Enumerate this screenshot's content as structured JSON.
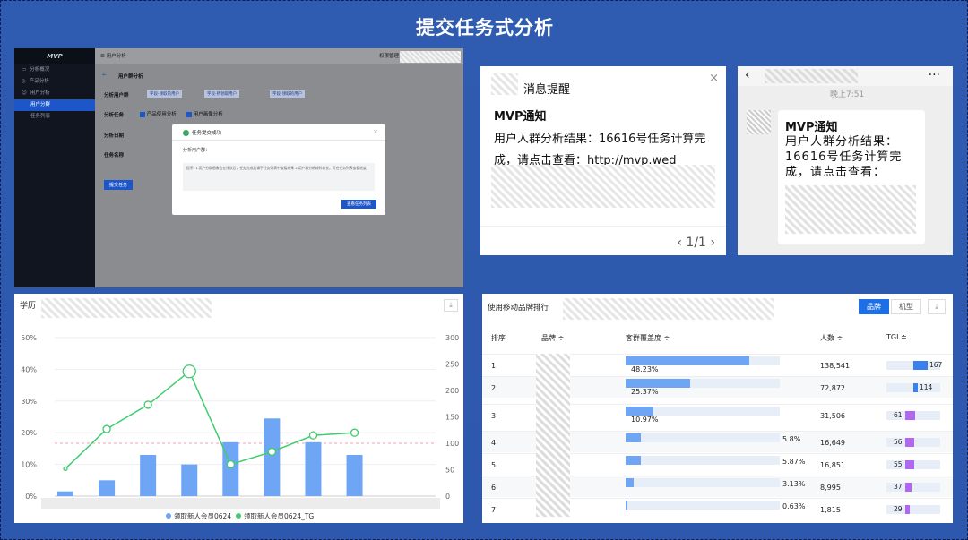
{
  "title": "提交任务式分析",
  "app": {
    "logo": "MVP",
    "topbar_left": "用户分析",
    "topbar_right": "权限管理",
    "nav": [
      {
        "label": "分析概况",
        "active": false,
        "sub": false
      },
      {
        "label": "产品分析",
        "active": false,
        "sub": false
      },
      {
        "label": "用户分析",
        "active": false,
        "sub": false
      },
      {
        "label": "用户分群",
        "active": true,
        "sub": true
      },
      {
        "label": "任务列表",
        "active": false,
        "sub": true
      }
    ],
    "page_title": "用户群分析",
    "form_labels": {
      "users": "分析用户群",
      "task": "分析任务",
      "date": "分析日期",
      "name": "任务名称"
    },
    "tags": [
      "字段-领取的用户",
      "字段-所领取用户",
      "字段-领取的用户"
    ],
    "task_options": [
      "产品使用分析",
      "用户画像分析"
    ],
    "submit": "提交任务",
    "modal": {
      "title": "任务提交成功",
      "field": "分析用户群：",
      "tips": "提示:\n1.用户分群画像会在排队后，任务完成后请于任务列表中查看结果\n2.用户群分析耗时较长，可在任务列表查看进度",
      "button": "查看任务列表"
    }
  },
  "notice": {
    "header": "消息提醒",
    "title": "MVP通知",
    "body": "用户人群分析结果：16616号任务计算完成，请点击查看：http://mvp.wed",
    "pager": "‹ 1/1 ›"
  },
  "chat": {
    "time": "晚上7:51",
    "title": "MVP通知",
    "body": "用户人群分析结果：16616号任务计算完成，请点击查看："
  },
  "education_chart": {
    "title": "学历",
    "legend": [
      "领取新人会员0624",
      "领取新人会员0624_TGI"
    ],
    "colors": {
      "bar": "#6ea6f5",
      "line": "#3fcc6e",
      "ref": "#f0a0b0"
    }
  },
  "chart_data": {
    "type": "bar",
    "title": "学历",
    "categories": [
      "",
      "",
      "",
      "",
      "",
      "",
      "",
      "",
      ""
    ],
    "series": [
      {
        "name": "领取新人会员0624",
        "values": [
          1.5,
          5,
          13,
          10,
          17,
          24.5,
          17,
          13,
          0
        ]
      },
      {
        "name": "领取新人会员0624_TGI",
        "values": [
          52,
          127,
          173,
          236,
          60,
          84,
          115,
          120,
          null
        ]
      }
    ],
    "y_left_ticks": [
      "0%",
      "10%",
      "20%",
      "30%",
      "40%",
      "50%"
    ],
    "y_right_ticks": [
      "0",
      "50",
      "100",
      "150",
      "200",
      "250",
      "300"
    ],
    "ylim": [
      0,
      50
    ],
    "y2lim": [
      0,
      300
    ],
    "reference_y2": 100
  },
  "brand_table": {
    "title": "使用移动品牌排行",
    "toggle": [
      "品牌",
      "机型"
    ],
    "headers": [
      "排序",
      "品牌 ≑",
      "客群覆盖度 ≑",
      "人数 ≑",
      "TGI ≑"
    ],
    "rows": [
      {
        "rank": "1",
        "coverage": "48.23%",
        "coverage_value": 48.23,
        "count": "138,541",
        "tgi": "167",
        "tgi_value": 167
      },
      {
        "rank": "2",
        "coverage": "25.37%",
        "coverage_value": 25.37,
        "count": "72,872",
        "tgi": "114",
        "tgi_value": 114
      },
      {
        "rank": "3",
        "coverage": "10.97%",
        "coverage_value": 10.97,
        "count": "31,506",
        "tgi": "61",
        "tgi_value": 61
      },
      {
        "rank": "4",
        "coverage": "5.8%",
        "coverage_value": 5.8,
        "count": "16,649",
        "tgi": "56",
        "tgi_value": 56
      },
      {
        "rank": "5",
        "coverage": "5.87%",
        "coverage_value": 5.87,
        "count": "16,851",
        "tgi": "55",
        "tgi_value": 55
      },
      {
        "rank": "6",
        "coverage": "3.13%",
        "coverage_value": 3.13,
        "count": "8,995",
        "tgi": "37",
        "tgi_value": 37
      },
      {
        "rank": "7",
        "coverage": "0.63%",
        "coverage_value": 0.63,
        "count": "1,815",
        "tgi": "29",
        "tgi_value": 29
      }
    ],
    "colors": {
      "coverage": "#6ea6f5",
      "tgi_high": "#3a7ff0",
      "tgi_low": "#b167f0"
    }
  }
}
